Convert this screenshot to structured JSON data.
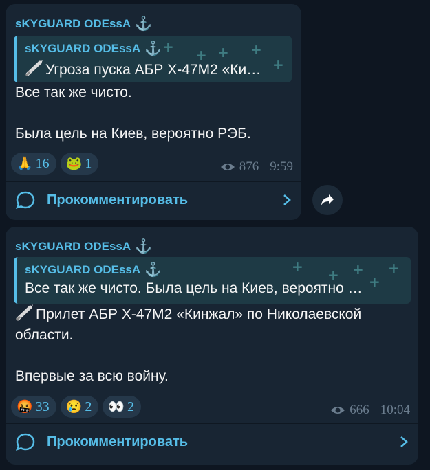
{
  "colors": {
    "background": "#0e1621",
    "bubble": "#182533",
    "accent": "#56bde7",
    "muted": "#6b7d8e",
    "quote_bg": "#1e3a45"
  },
  "messages": [
    {
      "author": "sKYGUARD ODEssA",
      "author_icon": "anchor-icon",
      "reply": {
        "author": "sKYGUARD ODEssA",
        "text": "Угроза пуска АБР Х-47М2 «Ки…",
        "icon": "missile-icon"
      },
      "text": "Все так же чисто.\n\nБыла цель на Киев, вероятно РЭБ.",
      "reactions": [
        {
          "emoji": "🙏",
          "icon": "praying-hands-icon",
          "count": "16"
        },
        {
          "emoji": "🐸",
          "icon": "frog-heart-icon",
          "count": "1"
        }
      ],
      "views": "876",
      "time": "9:59",
      "comment_label": "Прокомментировать"
    },
    {
      "author": "sKYGUARD ODEssA",
      "author_icon": "anchor-icon",
      "reply": {
        "author": "sKYGUARD ODEssA",
        "text": "Все так же чисто.  Была цель на Киев, вероятно …",
        "icon": null
      },
      "text_line1": "Прилет АБР Х-47М2 «Кинжал» по Николаевской области.",
      "text_rest": "\n\nВпервые за всю войну.",
      "reactions": [
        {
          "emoji": "🤬",
          "icon": "cursing-face-icon",
          "count": "33"
        },
        {
          "emoji": "😢",
          "icon": "crying-face-icon",
          "count": "2"
        },
        {
          "emoji": "👀",
          "icon": "ghost-eyes-icon",
          "count": "2"
        }
      ],
      "views": "666",
      "time": "10:04",
      "comment_label": "Прокомментировать"
    }
  ]
}
